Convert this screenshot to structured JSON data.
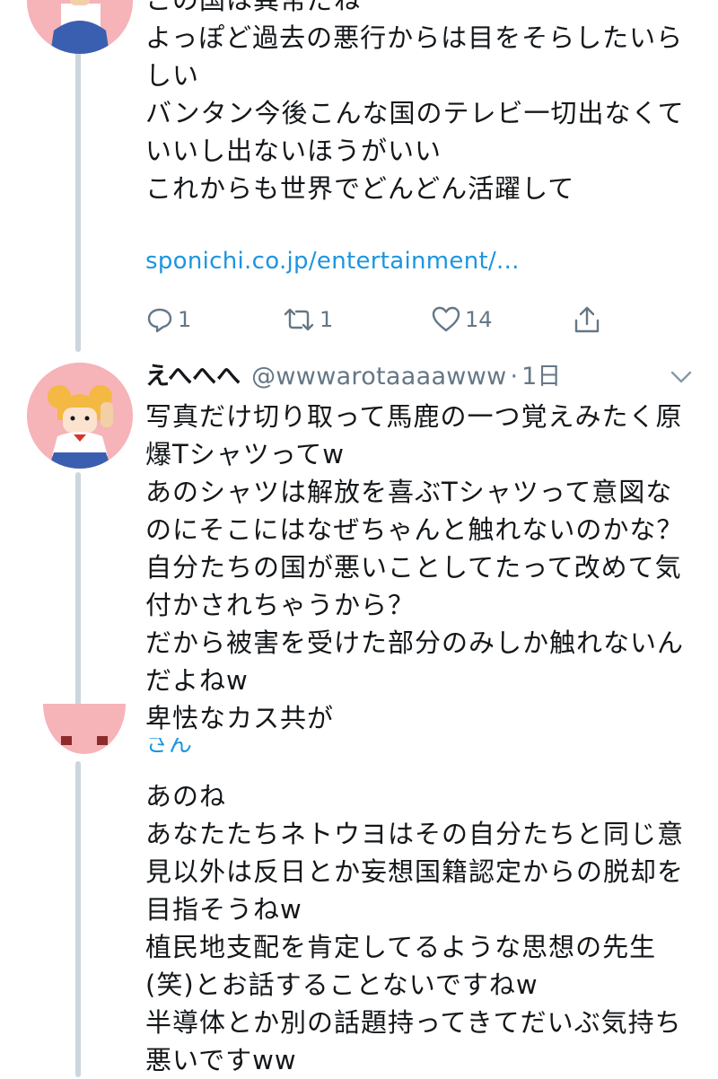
{
  "tweet1": {
    "lines": [
      "この国は異常だね",
      "よっぽど過去の悪行からは目をそらしたいら",
      "しい",
      "バンタン今後こんな国のテレビ一切出なくて",
      "いいし出ないほうがいい",
      "これからも世界でどんどん活躍して"
    ],
    "link": "sponichi.co.jp/entertainment/...",
    "actions": {
      "reply_count": "1",
      "retweet_count": "1",
      "like_count": "14"
    }
  },
  "tweet2": {
    "display_name": "えへへへ",
    "handle": "@wwwarotaaaawww",
    "separator": "·",
    "time": "1日",
    "lines": [
      "写真だけ切り取って馬鹿の一つ覚えみたく原",
      "爆Tシャツってw",
      "あのシャツは解放を喜ぶTシャツって意図な",
      "のにそこにはなぜちゃんと触れないのかな？",
      "自分たちの国が悪いことしてたって改めて気",
      "付かされちゃうから？",
      "だから被害を受けた部分のみしか触れないん",
      "だよねw",
      "卑怯なカス共が"
    ]
  },
  "tweet3": {
    "partial_name": "さん",
    "lines": [
      "あのね",
      "あなたたちネトウヨはその自分たちと同じ意",
      "見以外は反日とか妄想国籍認定からの脱却を",
      "目指そうねw",
      "植民地支配を肯定してるような思想の先生",
      "(笑)とお話することないですねw",
      "半導体とか別の話題持ってきてだいぶ気持ち",
      "悪いですww"
    ]
  },
  "icons": [
    "avatar",
    "reply-icon",
    "retweet-icon",
    "like-icon",
    "share-icon",
    "chevron-down-icon"
  ],
  "colors": {
    "link": "#1b95e0",
    "muted": "#657786",
    "thread_line": "#ccd6dd",
    "avatar_bg": "#f6b3b8"
  }
}
